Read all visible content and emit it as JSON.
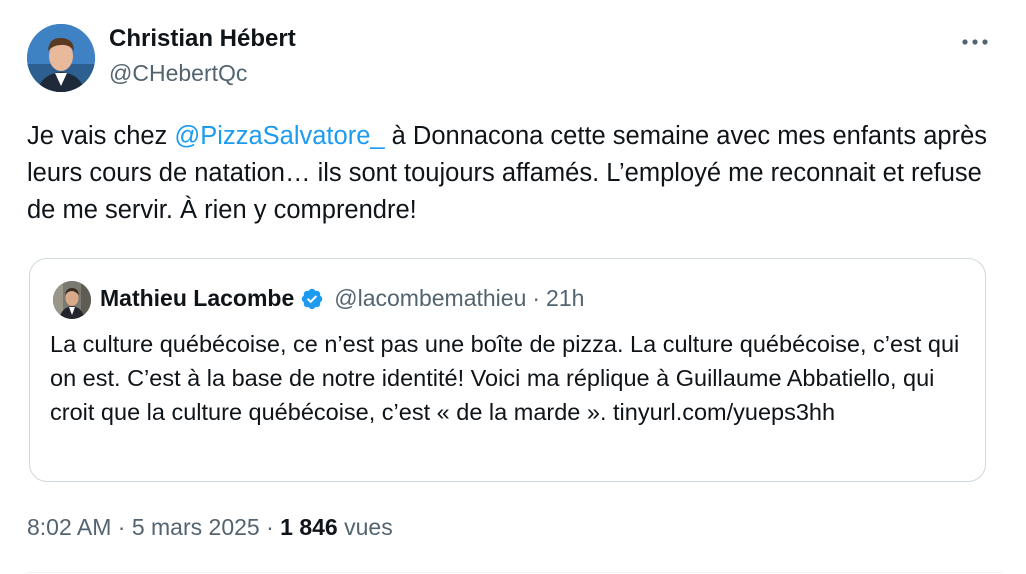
{
  "tweet": {
    "author": {
      "name": "Christian Hébert",
      "handle": "@CHebertQc"
    },
    "text": {
      "prefix": "Je vais chez ",
      "mention": "@PizzaSalvatore_",
      "suffix": " à Donnacona cette semaine avec mes enfants après leurs cours de natation… ils sont toujours affamés. L’employé me reconnait et refuse de me servir. À rien y comprendre!"
    },
    "quote": {
      "name": "Mathieu Lacombe",
      "handle": "@lacombemathieu",
      "separator": "·",
      "time": "21h",
      "text": "La culture québécoise, ce n’est pas une boîte de pizza. La culture québécoise, c’est qui on est. C’est à la base de notre identité! Voici ma réplique à Guillaume Abbatiello, qui croit que la culture québécoise, c’est « de la marde ». tinyurl.com/yueps3hh"
    },
    "meta": {
      "time": "8:02 AM",
      "separator": "·",
      "date": "5 mars 2025",
      "views_count": "1 846",
      "views_label": "vues"
    }
  },
  "colors": {
    "accent": "#1d9bf0",
    "secondary_text": "#536471",
    "primary_text": "#0f1419",
    "border": "#cfd9de"
  },
  "icons": {
    "more": "more-horizontal-icon",
    "verified": "verified-badge-icon"
  }
}
